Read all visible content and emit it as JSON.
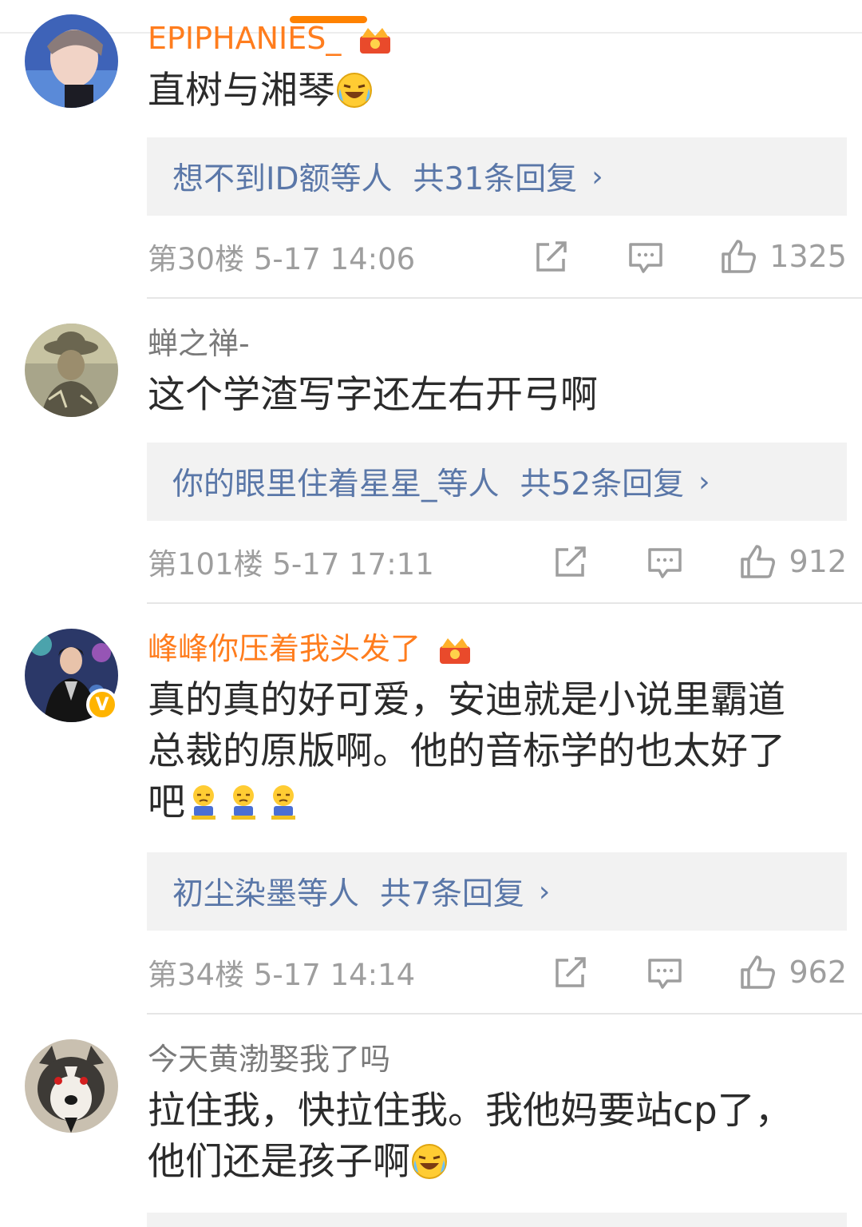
{
  "comments": [
    {
      "username": "EPIPHANIES_",
      "text": "直树与湘琴",
      "replies": {
        "people": "想不到ID额等人",
        "count": "共31条回复",
        "chevron": "›"
      },
      "floor": "第30楼 5-17 14:06",
      "likes": "1325"
    },
    {
      "username": "蝉之禅-",
      "text": "这个学渣写字还左右开弓啊",
      "replies": {
        "people": "你的眼里住着星星_等人",
        "count": "共52条回复",
        "chevron": "›"
      },
      "floor": "第101楼 5-17 17:11",
      "likes": "912"
    },
    {
      "username": "峰峰你压着我头发了",
      "verified_mark": "V",
      "text_line1": "真的真的好可爱，安迪就是小说里霸道",
      "text_line2": "总裁的原版啊。他的音标学的也太好了",
      "text_line3": "吧",
      "replies": {
        "people": "初尘染墨等人",
        "count": "共7条回复",
        "chevron": "›"
      },
      "floor": "第34楼 5-17 14:14",
      "likes": "962"
    },
    {
      "username": "今天黄渤娶我了吗",
      "text_line1": "拉住我，快拉住我。我他妈要站cp了，",
      "text_line2": "他们还是孩子啊"
    }
  ],
  "colors": {
    "accent": "#ff8200",
    "vip_name": "#ff7d1e",
    "reply_link": "#5a77a8",
    "meta_text": "#9e9e9e",
    "reply_bg": "#f2f2f2"
  }
}
